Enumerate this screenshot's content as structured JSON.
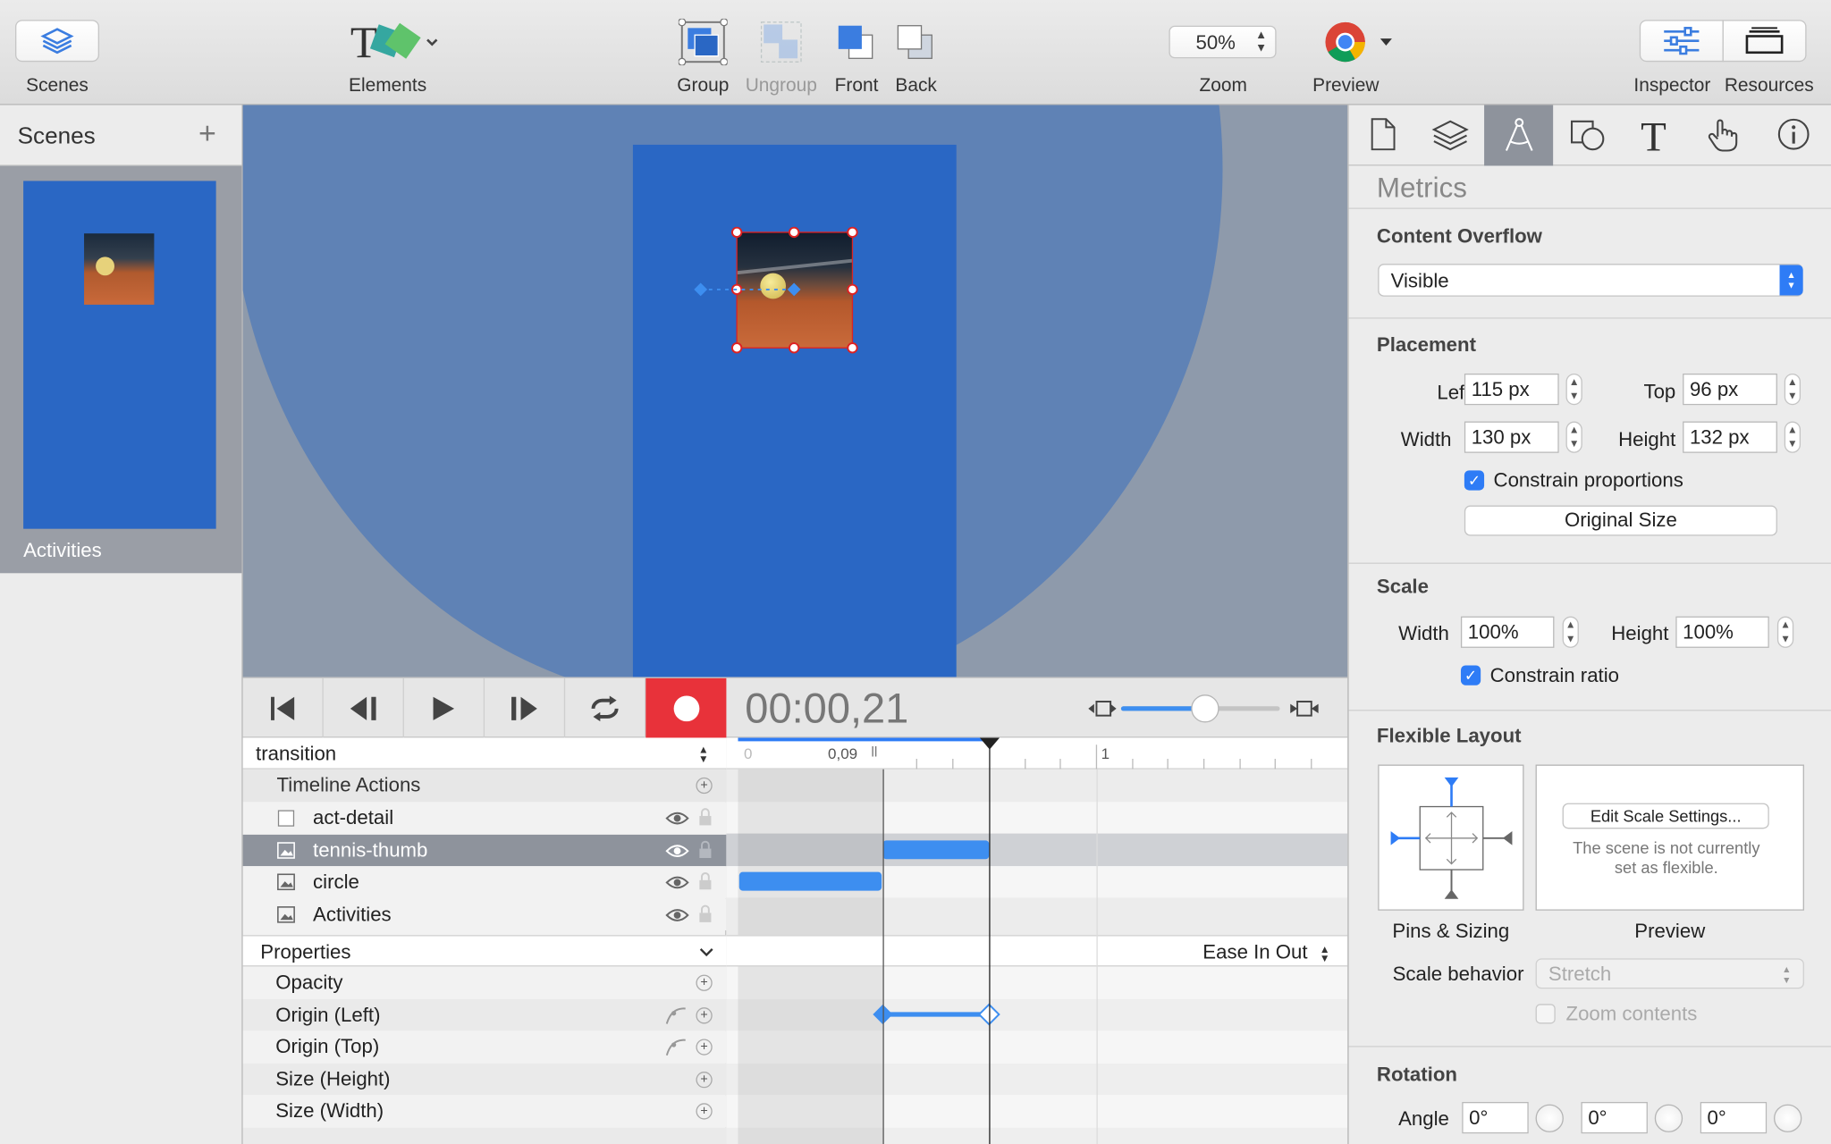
{
  "toolbar": {
    "scenes_label": "Scenes",
    "elements_label": "Elements",
    "group_label": "Group",
    "ungroup_label": "Ungroup",
    "front_label": "Front",
    "back_label": "Back",
    "zoom_value": "50%",
    "zoom_label": "Zoom",
    "preview_label": "Preview",
    "inspector_label": "Inspector",
    "resources_label": "Resources"
  },
  "scenes_panel": {
    "title": "Scenes",
    "scenes": [
      {
        "name": "Activities"
      }
    ]
  },
  "transport": {
    "time": "00:00,21"
  },
  "timeline": {
    "selector": "transition",
    "ruler_labels": [
      "0",
      "0,09",
      "1"
    ],
    "actions_label": "Timeline Actions",
    "layers": [
      {
        "name": "act-detail",
        "icon": "checkbox-icon",
        "selected": false
      },
      {
        "name": "tennis-thumb",
        "icon": "image-icon",
        "selected": true
      },
      {
        "name": "circle",
        "icon": "image-icon",
        "selected": false
      },
      {
        "name": "Activities",
        "icon": "image-icon",
        "selected": false
      }
    ],
    "properties_label": "Properties",
    "easing": "Ease In Out",
    "properties": [
      "Opacity",
      "Origin (Left)",
      "Origin (Top)",
      "Size (Height)",
      "Size (Width)"
    ]
  },
  "inspector": {
    "tabs": [
      "document-icon",
      "layers-icon",
      "metrics-icon",
      "shapes-icon",
      "text-icon",
      "actions-icon",
      "info-icon"
    ],
    "active_tab": "metrics-icon",
    "section_title": "Metrics",
    "content_overflow": {
      "label": "Content Overflow",
      "value": "Visible"
    },
    "placement": {
      "label": "Placement",
      "left_label": "Left",
      "left": "115 px",
      "top_label": "Top",
      "top": "96 px",
      "width_label": "Width",
      "width": "130 px",
      "height_label": "Height",
      "height": "132 px",
      "constrain_label": "Constrain proportions",
      "original_size_label": "Original Size"
    },
    "scale": {
      "label": "Scale",
      "width_label": "Width",
      "width": "100%",
      "height_label": "Height",
      "height": "100%",
      "constrain_label": "Constrain ratio"
    },
    "flexible_layout": {
      "label": "Flexible Layout",
      "pins_label": "Pins & Sizing",
      "preview_label": "Preview",
      "edit_button": "Edit Scale Settings...",
      "preview_note_1": "The scene is not currently",
      "preview_note_2": "set as flexible.",
      "scale_behavior_label": "Scale behavior",
      "scale_behavior_value": "Stretch",
      "zoom_contents_label": "Zoom contents"
    },
    "rotation": {
      "label": "Rotation",
      "angle_label": "Angle",
      "values": [
        "0°",
        "0°",
        "0°"
      ]
    }
  },
  "colors": {
    "accent": "#2e7cf6",
    "scene_blue": "#2a67c4",
    "circle_blue": "#5f82b5",
    "record_red": "#e8323a",
    "keyframe_blue": "#3d8ef0"
  }
}
